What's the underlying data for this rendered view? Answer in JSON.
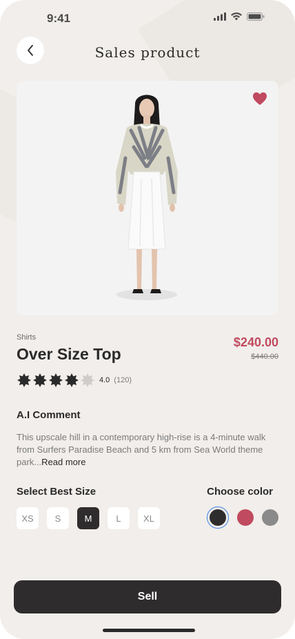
{
  "status_bar": {
    "time": "9:41",
    "icons": [
      "signal-icon",
      "wifi-icon",
      "battery-icon"
    ]
  },
  "header": {
    "title": "Sales product",
    "back_icon": "chevron-left-icon"
  },
  "product": {
    "category": "Shirts",
    "name": "Over Size Top",
    "price": "$240.00",
    "old_price": "$440.00",
    "rating": {
      "value": "4.0",
      "count": "(120)",
      "stars_filled": 4,
      "stars_total": 5
    },
    "favorite": true
  },
  "ai_comment": {
    "title": "A.I Comment",
    "text": "This upscale hill in a contemporary high-rise is a 4-minute walk from Surfers Paradise Beach and 5 km from Sea World theme park...",
    "read_more": "Read more"
  },
  "size_select": {
    "title": "Select Best Size",
    "options": [
      "XS",
      "S",
      "M",
      "L",
      "XL"
    ],
    "selected": "M"
  },
  "color_select": {
    "title": "Choose color",
    "options": [
      "#2e2c2c",
      "#c04a5f",
      "#8a8a8a"
    ],
    "selected": "#2e2c2c"
  },
  "actions": {
    "sell_label": "Sell"
  },
  "colors": {
    "accent": "#c04a5f",
    "dark": "#2e2c2c",
    "background": "#f1eeeb",
    "selection_ring": "#3d7ee5"
  }
}
